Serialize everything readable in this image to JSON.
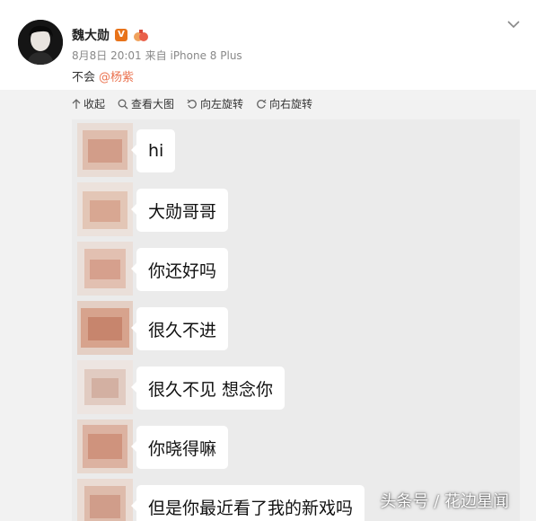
{
  "post": {
    "author": "魏大勋",
    "verified_badge": "V",
    "date": "8月8日 20:01",
    "source": "来自 iPhone 8 Plus",
    "text": "不会",
    "mention": "@杨紫"
  },
  "toolbar": {
    "collapse_label": "收起",
    "view_large_label": "查看大图",
    "rotate_left_label": "向左旋转",
    "rotate_right_label": "向右旋转"
  },
  "chat": {
    "messages": [
      {
        "text": "hi"
      },
      {
        "text": "大勋哥哥"
      },
      {
        "text": "你还好吗"
      },
      {
        "text": "很久不进"
      },
      {
        "text": "很久不见 想念你"
      },
      {
        "text": "你晓得嘛"
      },
      {
        "text": "但是你最近看了我的新戏吗"
      }
    ]
  },
  "watermark": "头条号 / 花边星闻",
  "colors": {
    "accent": "#eb7350",
    "badge": "#e8731a",
    "chat_background": "#ebebeb"
  },
  "icons": {
    "collapse": "arrow-up-icon",
    "view_large": "search-icon",
    "rotate_left": "rotate-left-icon",
    "rotate_right": "rotate-right-icon",
    "menu": "chevron-down-icon"
  }
}
